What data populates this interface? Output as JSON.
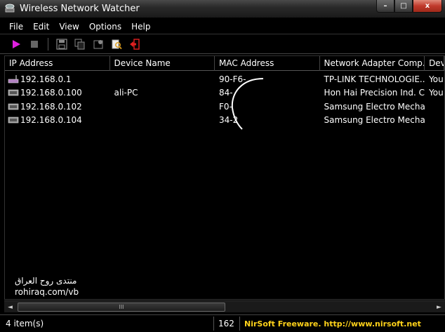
{
  "window": {
    "title": "Wireless Network Watcher",
    "buttons": {
      "minimize": "–",
      "maximize": "□",
      "close": "x"
    }
  },
  "menu": [
    "File",
    "Edit",
    "View",
    "Options",
    "Help"
  ],
  "toolbar": {
    "icons": [
      "play-icon",
      "stop-icon",
      "save-icon",
      "copy-icon",
      "properties-icon",
      "search-icon",
      "exit-icon"
    ],
    "colors": {
      "play": "#e020e0",
      "stop": "#666666",
      "exit": "#e02020"
    }
  },
  "columns": [
    "IP Address",
    "Device Name",
    "MAC Address",
    "Network Adapter Comp...",
    "Dev"
  ],
  "rows": [
    {
      "ip": "192.168.0.1",
      "device": "",
      "mac": "90-F6-",
      "adapter": "TP-LINK TECHNOLOGIE...",
      "dev": "You"
    },
    {
      "ip": "192.168.0.100",
      "device": "ali-PC",
      "mac": "84-",
      "adapter": "Hon Hai Precision Ind. C...",
      "dev": "You"
    },
    {
      "ip": "192.168.0.102",
      "device": "",
      "mac": "F0-",
      "adapter": "Samsung Electro Mecha...",
      "dev": ""
    },
    {
      "ip": "192.168.0.104",
      "device": "",
      "mac": "34-2",
      "adapter": "Samsung Electro Mecha...",
      "dev": ""
    }
  ],
  "watermark": {
    "arabic": "منتدى روح العراق",
    "url": "rohiraq.com/vb"
  },
  "scrollbar": {
    "grip": "III",
    "left_arrow": "◄",
    "right_arrow": "►"
  },
  "status": {
    "count": "4 item(s)",
    "number": "162",
    "link": "NirSoft Freeware.  http://www.nirsoft.net"
  }
}
